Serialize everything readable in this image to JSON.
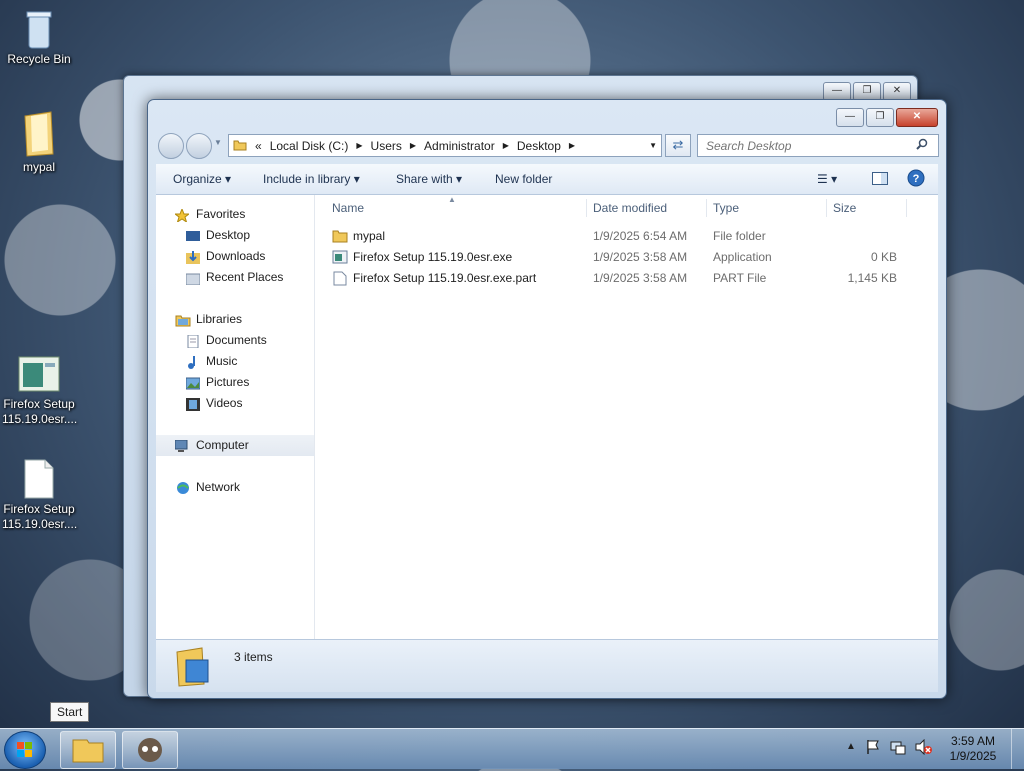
{
  "desktop": {
    "icons": [
      {
        "label": "Recycle Bin"
      },
      {
        "label": "mypal"
      },
      {
        "label": "Firefox Setup\n115.19.0esr...."
      },
      {
        "label": "Firefox Setup\n115.19.0esr...."
      }
    ]
  },
  "window": {
    "address": {
      "overflow": "«",
      "crumbs": [
        "Local Disk (C:)",
        "Users",
        "Administrator",
        "Desktop"
      ]
    },
    "search_placeholder": "Search Desktop",
    "toolbar": {
      "organize": "Organize",
      "include_in_library": "Include in library",
      "share_with": "Share with",
      "new_folder": "New folder"
    },
    "nav": {
      "favorites": "Favorites",
      "desktop": "Desktop",
      "downloads": "Downloads",
      "recent_places": "Recent Places",
      "libraries": "Libraries",
      "documents": "Documents",
      "music": "Music",
      "pictures": "Pictures",
      "videos": "Videos",
      "computer": "Computer",
      "network": "Network"
    },
    "columns": {
      "name": "Name",
      "date": "Date modified",
      "type": "Type",
      "size": "Size"
    },
    "files": [
      {
        "name": "mypal",
        "date": "1/9/2025 6:54 AM",
        "type": "File folder",
        "size": "",
        "icon": "folder-icon"
      },
      {
        "name": "Firefox Setup 115.19.0esr.exe",
        "date": "1/9/2025 3:58 AM",
        "type": "Application",
        "size": "0 KB",
        "icon": "application-icon"
      },
      {
        "name": "Firefox Setup 115.19.0esr.exe.part",
        "date": "1/9/2025 3:58 AM",
        "type": "PART File",
        "size": "1,145 KB",
        "icon": "file-icon"
      }
    ],
    "status": "3 items"
  },
  "taskbar": {
    "tooltip": "Start",
    "time": "3:59 AM",
    "date": "1/9/2025"
  }
}
